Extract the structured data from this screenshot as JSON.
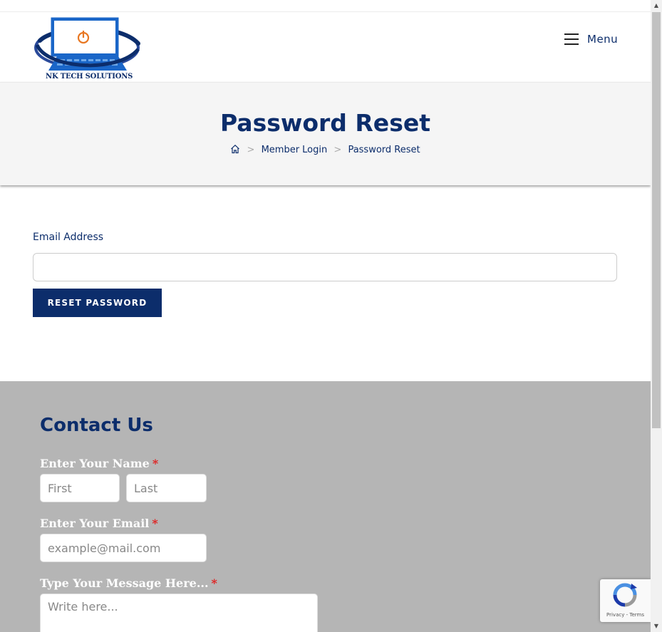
{
  "header": {
    "logo_text": "NK TECH SOLUTIONS",
    "menu_label": "Menu"
  },
  "title_band": {
    "title": "Password Reset",
    "breadcrumb": {
      "sep": ">",
      "items": [
        "Member Login",
        "Password Reset"
      ]
    }
  },
  "reset_form": {
    "email_label": "Email Address",
    "email_value": "",
    "button_label": "RESET PASSWORD"
  },
  "contact": {
    "title": "Contact Us",
    "name_label": "Enter Your Name",
    "first_placeholder": "First",
    "last_placeholder": "Last",
    "email_label": "Enter Your Email",
    "email_placeholder": "example@mail.com",
    "message_label": "Type Your Message Here...",
    "message_placeholder": "Write here...",
    "required_mark": "*"
  },
  "recaptcha": {
    "privacy": "Privacy",
    "dash": " - ",
    "terms": "Terms"
  },
  "colors": {
    "brand_navy": "#0c2d6b",
    "contact_bg": "#b5b5b5",
    "title_band_bg": "#f5f5f5",
    "required": "#e02020",
    "logo_orange": "#e87722"
  }
}
